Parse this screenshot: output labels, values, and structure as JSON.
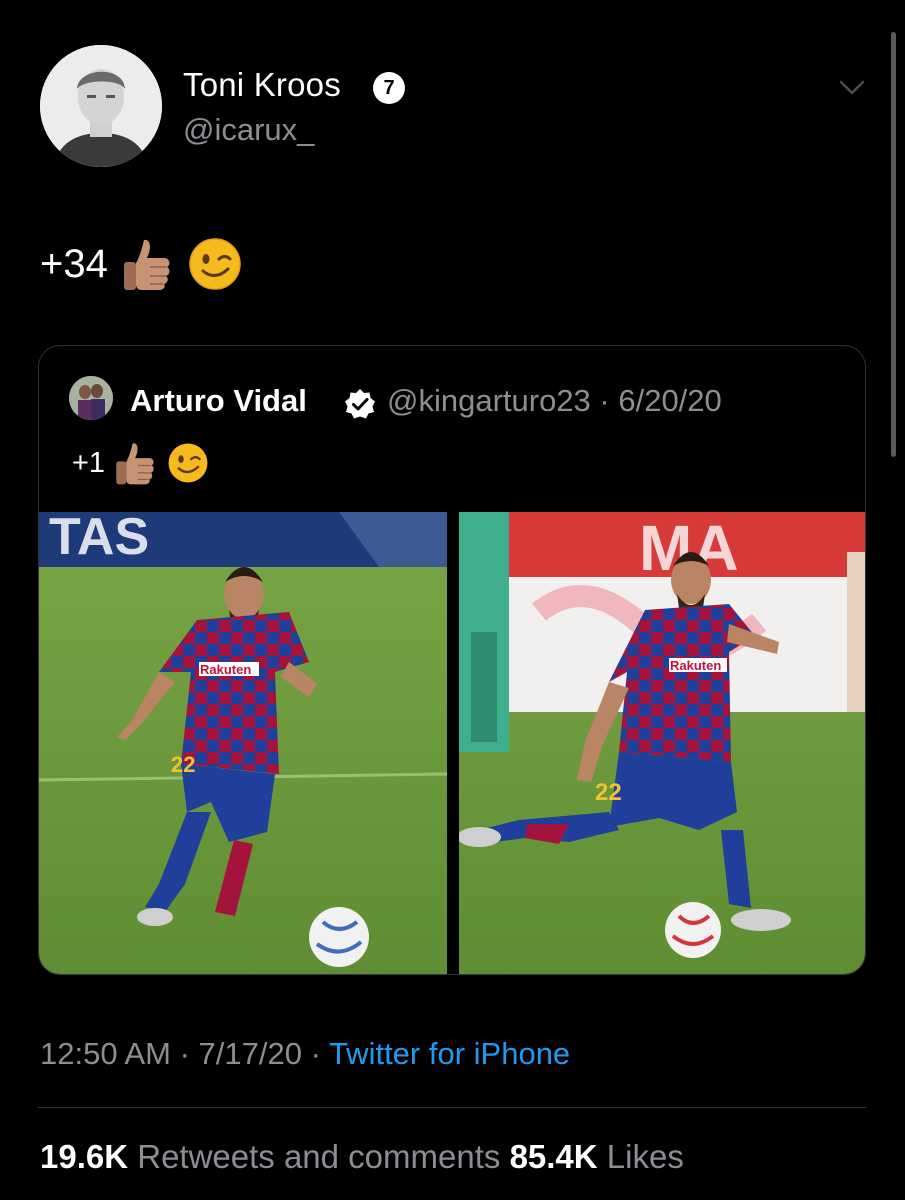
{
  "author": {
    "name": "Toni Kroos",
    "badge": "7",
    "handle": "@icarux_"
  },
  "tweet": {
    "text": "+34",
    "emojis": [
      "thumbs-up-medium-skin-icon",
      "winking-face-icon"
    ]
  },
  "quote": {
    "name": "Arturo Vidal",
    "handle_date": "@kingarturo23 · 6/20/20",
    "text": "+1",
    "emojis": [
      "thumbs-up-medium-skin-icon",
      "winking-face-icon"
    ],
    "jersey_number": "22",
    "sponsor": "Rakuten",
    "banner_left": "TAS",
    "banner_right": "MA"
  },
  "meta": {
    "time_date": "12:50 AM · 7/17/20 · ",
    "source": "Twitter for iPhone"
  },
  "stats": {
    "retweets_count": "19.6K",
    "retweets_label": " Retweets and comments ",
    "likes_count": "85.4K",
    "likes_label": " Likes"
  },
  "colors": {
    "background": "#000000",
    "text_primary": "#ffffff",
    "text_secondary": "#8b8f94",
    "link": "#1d9bf0",
    "border": "#2f3336",
    "pitch_green": "#6e9a3a",
    "barca_blue": "#1f3f9a",
    "barca_red": "#a3133c"
  }
}
